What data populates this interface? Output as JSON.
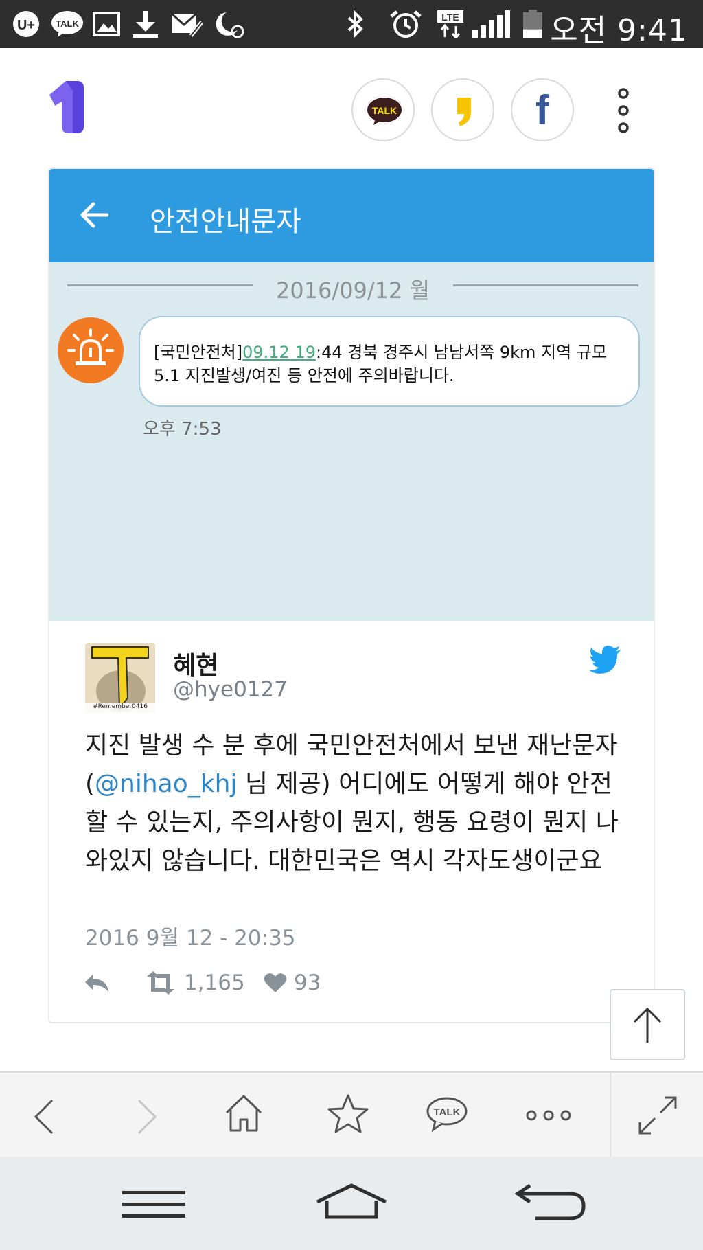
{
  "status_bar": {
    "time": "오전 9:41",
    "talk_badge": "TALK",
    "lte_badge": "LTE",
    "battery_level": 0.35,
    "icons": [
      "uplus-icon",
      "kakaotalk-icon",
      "gallery-icon",
      "download-icon",
      "mail-icon",
      "night-mode-icon",
      "bluetooth-icon",
      "alarm-icon",
      "lte-icon",
      "signal-icon",
      "battery-icon"
    ]
  },
  "header": {
    "logo_icon": "app-logo-icon",
    "share_buttons": [
      {
        "name": "kakaotalk-share",
        "label": "TALK"
      },
      {
        "name": "kakaostory-share",
        "label": ""
      },
      {
        "name": "facebook-share",
        "label": "f"
      }
    ],
    "more_icon": "more-vertical-icon"
  },
  "sms": {
    "title": "안전안내문자",
    "date": "2016/09/12 월",
    "message_prefix": "[국민안전처]",
    "message_link": "09.12 19",
    "message_rest": ":44 경북 경주시 남남서쪽 9km 지역 규모5.1 지진발생/여진 등 안전에 주의바랍니다.",
    "time": "오후 7:53",
    "colors": {
      "header": "#2e9be0",
      "background": "#daeaef",
      "alert_icon": "#f27a23"
    }
  },
  "tweet": {
    "name": "혜현",
    "handle": "@hye0127",
    "avatar_caption": "#Remember0416",
    "text_before": "지진 발생 수 분 후에 국민안전처에서 보낸 재난문자(",
    "mention": "@nihao_khj",
    "text_after": " 님 제공) 어디에도 어떻게 해야 안전할 수 있는지, 주의사항이 뭔지, 행동 요령이 뭔지 나와있지 않습니다. 대한민국은 역시 각자도생이군요",
    "timestamp": "2016 9월 12 - 20:35",
    "retweets": "1,165",
    "likes": "93",
    "colors": {
      "mention": "#2c87c8",
      "bird": "#1da1f2"
    }
  },
  "toolbar": {
    "items": [
      "back-icon",
      "forward-icon",
      "home-icon",
      "bookmark-star-icon",
      "kakaotalk-icon",
      "more-horizontal-icon",
      "fullscreen-icon"
    ],
    "talk_label": "TALK"
  },
  "navbar": {
    "items": [
      "menu-icon",
      "home-icon",
      "back-icon"
    ]
  }
}
